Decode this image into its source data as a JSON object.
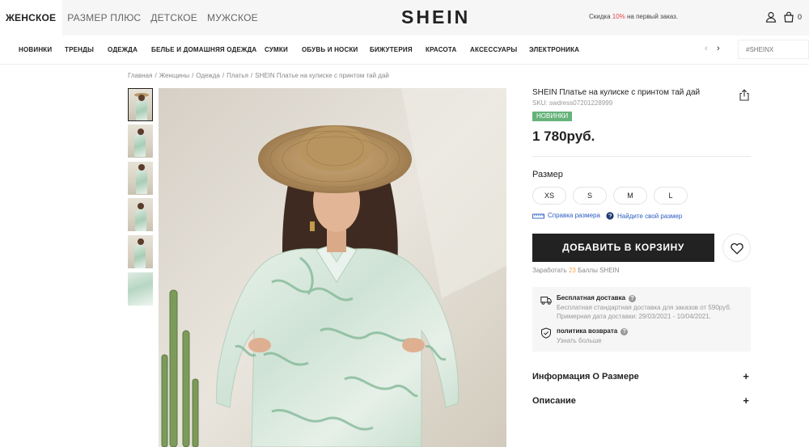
{
  "header": {
    "gender_tabs": [
      "ЖЕНСКОЕ",
      "РАЗМЕР ПЛЮС",
      "ДЕТСКОЕ",
      "МУЖСКОЕ"
    ],
    "logo": "SHEIN",
    "promo_prefix": "Скидка ",
    "promo_pct": "10%",
    "promo_suffix": " на первый заказ.",
    "bag_count": "0"
  },
  "nav": {
    "items": [
      "НОВИНКИ",
      "ТРЕНДЫ",
      "ОДЕЖДА",
      "БЕЛЬЕ И ДОМАШНЯЯ ОДЕЖДА",
      "СУМКИ",
      "ОБУВЬ И НОСКИ",
      "БИЖУТЕРИЯ",
      "КРАСОТА",
      "АКСЕССУАРЫ",
      "ЭЛЕКТРОНИКА"
    ],
    "prev_arrow": "‹",
    "next_arrow": "›",
    "search_placeholder": "#SHEINX"
  },
  "breadcrumb": {
    "items": [
      "Главная",
      "Женщины",
      "Одежда",
      "Платья",
      "SHEIN Платье на кулиске с принтом тай дай"
    ],
    "separator": "/"
  },
  "product": {
    "title": "SHEIN Платье на кулиске с принтом тай дай",
    "sku": "SKU: swdress07201228999",
    "badge": "НОВИНКИ",
    "price": "1 780руб.",
    "size_label": "Размер",
    "sizes": [
      "XS",
      "S",
      "M",
      "L"
    ],
    "size_guide": "Справка размера",
    "find_size": "Найдите свой размер",
    "add_to_cart": "ДОБАВИТЬ В КОРЗИНУ",
    "earn_prefix": "Заработать ",
    "earn_points": "23",
    "earn_suffix": " Баллы SHEIN"
  },
  "shipping": {
    "title": "Бесплатная доставка",
    "line1": "Бесплатная стандартная доставка для заказов от 590руб.",
    "line2": "Примерная дата доставки: 29/03/2021 - 10/04/2021.",
    "return_title": "политика возврата",
    "return_link": "Узнать больше"
  },
  "accordions": {
    "size_info": "Информация О Размере",
    "description": "Описание",
    "plus": "+"
  },
  "colors": {
    "badge_green": "#66b37a",
    "promo_red": "#e64545",
    "link_blue": "#2b5cc2",
    "points_orange": "#f7a54b",
    "dress_green": "#7fb694"
  },
  "icons": [
    "user-icon",
    "bag-icon",
    "share-icon",
    "ruler-icon",
    "size-finder-icon",
    "heart-icon",
    "truck-icon",
    "shield-icon",
    "question-icon"
  ]
}
